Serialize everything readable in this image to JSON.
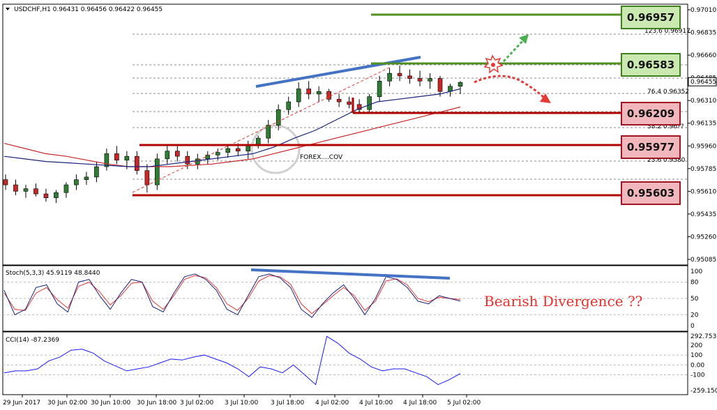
{
  "header": {
    "symbol_line": "USDCHF,H1  0.96431 0.96456 0.96422 0.96455"
  },
  "price_axis": {
    "labels": [
      "0.97010",
      "0.96835",
      "0.96660",
      "0.96485",
      "0.96310",
      "0.96135",
      "0.95960",
      "0.95785",
      "0.95610",
      "0.95435",
      "0.95260",
      "0.95085"
    ],
    "current_price": "0.96455"
  },
  "time_axis": {
    "labels": [
      "29 Jun 2017",
      "30 Jun 02:00",
      "30 Jun 10:00",
      "30 Jun 18:00",
      "3 Jul 02:00",
      "3 Jul 10:00",
      "3 Jul 18:00",
      "4 Jul 02:00",
      "4 Jul 10:00",
      "4 Jul 18:00",
      "5 Jul 02:00"
    ]
  },
  "fib_labels": {
    "f1": "123.6  0.96917",
    "f2": "76.4  0.96352",
    "f3": "38.2  0.96??",
    "f4": "23.6  0.9580"
  },
  "levels": {
    "resistance": [
      "0.96957",
      "0.96583"
    ],
    "support": [
      "0.96209",
      "0.95977",
      "0.95603"
    ]
  },
  "watermark": "FOREX....COV",
  "annotation": "Bearish Divergence ??",
  "stoch": {
    "title": "Stoch(5,3,3) 45.9119 48.8440",
    "axis_labels": [
      "100",
      "80",
      "50",
      "20",
      "0"
    ]
  },
  "cci": {
    "title": "CCI(14) -87.2369",
    "axis_labels": [
      "292.7539",
      "200",
      "100",
      "0.00",
      "-100",
      "-259.1508"
    ]
  },
  "colors": {
    "bull": "#2e7d32",
    "bear": "#c62828",
    "ma_fast": "#1a237e",
    "ma_slow": "#c62828",
    "trend": "#4472c4",
    "resistance": "#4f8f23",
    "support": "#b00000"
  },
  "chart_data": [
    {
      "type": "candlestick",
      "title": "USDCHF,H1",
      "ylim": [
        0.9505,
        0.9705
      ],
      "ohlc": [
        [
          0.957,
          0.9574,
          0.9562,
          0.9566
        ],
        [
          0.9566,
          0.957,
          0.9558,
          0.9561
        ],
        [
          0.9561,
          0.9566,
          0.9556,
          0.9563
        ],
        [
          0.9563,
          0.9567,
          0.9557,
          0.9559
        ],
        [
          0.9559,
          0.9563,
          0.9553,
          0.9556
        ],
        [
          0.9556,
          0.9562,
          0.9552,
          0.956
        ],
        [
          0.956,
          0.9568,
          0.9556,
          0.9566
        ],
        [
          0.9566,
          0.9574,
          0.9562,
          0.957
        ],
        [
          0.957,
          0.9576,
          0.9566,
          0.9572
        ],
        [
          0.9572,
          0.9584,
          0.9568,
          0.958
        ],
        [
          0.958,
          0.9594,
          0.9577,
          0.959
        ],
        [
          0.959,
          0.9596,
          0.9582,
          0.9585
        ],
        [
          0.9585,
          0.9592,
          0.9578,
          0.9588
        ],
        [
          0.9588,
          0.9592,
          0.9574,
          0.9577
        ],
        [
          0.9577,
          0.9582,
          0.956,
          0.9566
        ],
        [
          0.9566,
          0.959,
          0.9562,
          0.9586
        ],
        [
          0.9586,
          0.9596,
          0.9582,
          0.9592
        ],
        [
          0.9592,
          0.9596,
          0.9584,
          0.9588
        ],
        [
          0.9588,
          0.9592,
          0.9578,
          0.9582
        ],
        [
          0.9582,
          0.959,
          0.9578,
          0.9586
        ],
        [
          0.9586,
          0.9592,
          0.9582,
          0.9589
        ],
        [
          0.9589,
          0.9594,
          0.9585,
          0.9591
        ],
        [
          0.9591,
          0.9596,
          0.9587,
          0.9594
        ],
        [
          0.9594,
          0.9598,
          0.9588,
          0.9592
        ],
        [
          0.9592,
          0.96,
          0.9586,
          0.9596
        ],
        [
          0.9596,
          0.9604,
          0.9594,
          0.9602
        ],
        [
          0.9602,
          0.9616,
          0.9598,
          0.9612
        ],
        [
          0.9612,
          0.9628,
          0.9608,
          0.9624
        ],
        [
          0.9624,
          0.9634,
          0.962,
          0.963
        ],
        [
          0.963,
          0.9645,
          0.9626,
          0.964
        ],
        [
          0.964,
          0.9646,
          0.9632,
          0.9636
        ],
        [
          0.9636,
          0.9642,
          0.963,
          0.9638
        ],
        [
          0.9638,
          0.964,
          0.963,
          0.9632
        ],
        [
          0.9632,
          0.9636,
          0.9626,
          0.963
        ],
        [
          0.963,
          0.9634,
          0.9625,
          0.9628
        ],
        [
          0.9628,
          0.9632,
          0.9622,
          0.9624
        ],
        [
          0.9624,
          0.9636,
          0.9621,
          0.9634
        ],
        [
          0.9634,
          0.965,
          0.963,
          0.9646
        ],
        [
          0.9646,
          0.9656,
          0.9642,
          0.9652
        ],
        [
          0.9652,
          0.9658,
          0.9646,
          0.965
        ],
        [
          0.965,
          0.9655,
          0.9644,
          0.9648
        ],
        [
          0.9648,
          0.9654,
          0.9642,
          0.9646
        ],
        [
          0.9646,
          0.9652,
          0.964,
          0.9648
        ],
        [
          0.9648,
          0.965,
          0.9634,
          0.9638
        ],
        [
          0.9638,
          0.9644,
          0.9634,
          0.9642
        ],
        [
          0.9642,
          0.9646,
          0.9636,
          0.9645
        ]
      ],
      "ma_fast": [
        0.9588,
        0.9586,
        0.9584,
        0.9583,
        0.9582,
        0.9581,
        0.958,
        0.958,
        0.9582,
        0.9584,
        0.9586,
        0.9588,
        0.959,
        0.9595,
        0.9602,
        0.9608,
        0.9616,
        0.9624,
        0.963,
        0.9632,
        0.9634,
        0.9636,
        0.964
      ],
      "ma_slow": [
        0.9598,
        0.9594,
        0.959,
        0.9588,
        0.9585,
        0.9582,
        0.958,
        0.958,
        0.958,
        0.9581,
        0.9582,
        0.9584,
        0.9586,
        0.959,
        0.9594,
        0.9598,
        0.9602,
        0.9606,
        0.961,
        0.9614,
        0.9618,
        0.9622,
        0.9626
      ]
    },
    {
      "type": "line",
      "title": "Stoch(5,3,3) 45.9119 48.8440",
      "ylim": [
        0,
        100
      ],
      "series": [
        {
          "values": [
            65,
            20,
            30,
            70,
            75,
            40,
            25,
            80,
            85,
            55,
            30,
            60,
            85,
            80,
            35,
            25,
            60,
            90,
            95,
            85,
            65,
            30,
            20,
            55,
            90,
            95,
            88,
            70,
            30,
            15,
            40,
            60,
            75,
            50,
            20,
            50,
            90,
            85,
            70,
            45,
            40,
            55,
            50,
            45
          ]
        },
        {
          "values": [
            60,
            30,
            28,
            60,
            70,
            48,
            32,
            72,
            80,
            62,
            38,
            55,
            78,
            80,
            45,
            30,
            55,
            85,
            92,
            88,
            70,
            40,
            28,
            50,
            82,
            92,
            90,
            76,
            40,
            22,
            38,
            55,
            70,
            55,
            28,
            45,
            82,
            86,
            75,
            50,
            44,
            52,
            50,
            48
          ]
        }
      ]
    },
    {
      "type": "line",
      "title": "CCI(14) -87.2369",
      "ylim": [
        -259.1508,
        292.7539
      ],
      "series": [
        {
          "values": [
            -80,
            -60,
            -60,
            -40,
            40,
            80,
            150,
            160,
            120,
            40,
            -10,
            -60,
            -40,
            -20,
            20,
            60,
            50,
            80,
            100,
            60,
            20,
            -40,
            -120,
            -20,
            -40,
            -80,
            0,
            -100,
            -200,
            290,
            220,
            120,
            60,
            -20,
            -60,
            -40,
            -40,
            -80,
            -120,
            -200,
            -150,
            -87
          ]
        }
      ]
    }
  ]
}
